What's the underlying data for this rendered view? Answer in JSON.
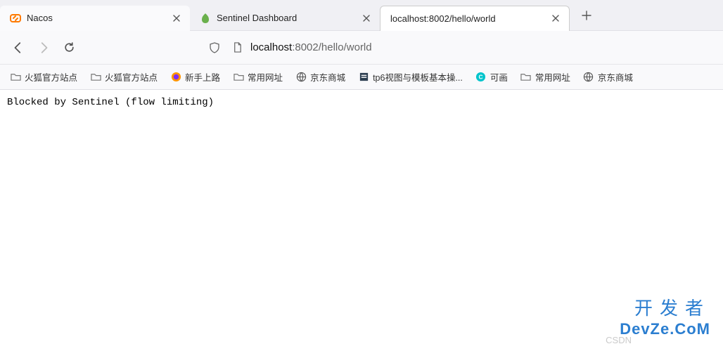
{
  "tabs": [
    {
      "label": "Nacos",
      "icon": "nacos-icon"
    },
    {
      "label": "Sentinel Dashboard",
      "icon": "sentinel-icon"
    },
    {
      "label": "localhost:8002/hello/world",
      "icon": ""
    }
  ],
  "url": {
    "host": "localhost",
    "port_path": ":8002/hello/world"
  },
  "bookmarks": [
    {
      "label": "火狐官方站点",
      "icon": "folder-icon"
    },
    {
      "label": "火狐官方站点",
      "icon": "folder-icon"
    },
    {
      "label": "新手上路",
      "icon": "firefox-icon"
    },
    {
      "label": "常用网址",
      "icon": "folder-icon"
    },
    {
      "label": "京东商城",
      "icon": "globe-icon"
    },
    {
      "label": "tp6视图与模板基本操...",
      "icon": "page-icon"
    },
    {
      "label": "可画",
      "icon": "canva-icon"
    },
    {
      "label": "常用网址",
      "icon": "folder-icon"
    },
    {
      "label": "京东商城",
      "icon": "globe-icon"
    }
  ],
  "page": {
    "body_text": "Blocked by Sentinel (flow limiting)"
  },
  "watermark": {
    "top": "开发者",
    "bottom": "DevZe.CoM",
    "csdn": "CSDN"
  }
}
